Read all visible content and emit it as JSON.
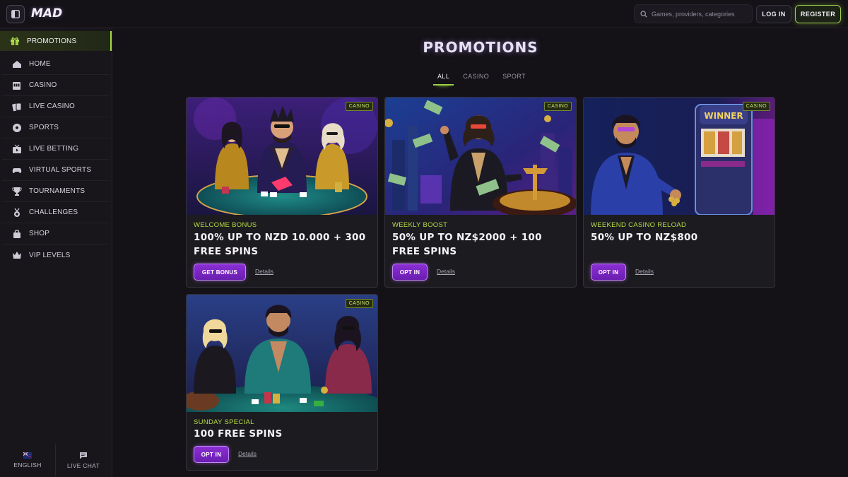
{
  "header": {
    "logo": "MAD",
    "search_placeholder": "Games, providers, categories",
    "login_label": "LOG IN",
    "register_label": "REGISTER"
  },
  "sidebar": {
    "items": [
      {
        "label": "PROMOTIONS",
        "icon": "gift-icon",
        "active": true
      },
      {
        "label": "HOME",
        "icon": "home-icon"
      },
      {
        "label": "CASINO",
        "icon": "slot-machine-icon"
      },
      {
        "label": "LIVE CASINO",
        "icon": "cards-icon"
      },
      {
        "label": "SPORTS",
        "icon": "soccer-ball-icon"
      },
      {
        "label": "LIVE BETTING",
        "icon": "tv-icon"
      },
      {
        "label": "VIRTUAL SPORTS",
        "icon": "gamepad-icon"
      },
      {
        "label": "TOURNAMENTS",
        "icon": "trophy-icon"
      },
      {
        "label": "CHALLENGES",
        "icon": "medal-icon"
      },
      {
        "label": "SHOP",
        "icon": "bag-icon"
      },
      {
        "label": "VIP LEVELS",
        "icon": "crown-icon"
      }
    ],
    "language_label": "ENGLISH",
    "live_chat_label": "LIVE CHAT"
  },
  "main": {
    "title": "PROMOTIONS",
    "filters": [
      "ALL",
      "CASINO",
      "SPORT"
    ],
    "active_filter": "ALL",
    "promotions": [
      {
        "badge": "CASINO",
        "category": "WELCOME BONUS",
        "headline": "100% UP TO NZD 10.000 + 300 FREE SPINS",
        "cta": "GET BONUS",
        "details": "Details"
      },
      {
        "badge": "CASINO",
        "category": "WEEKLY BOOST",
        "headline": "50% UP TO NZ$2000 + 100 FREE SPINS",
        "cta": "OPT IN",
        "details": "Details"
      },
      {
        "badge": "CASINO",
        "category": "WEEKEND CASINO RELOAD",
        "headline": "50% UP TO NZ$800",
        "cta": "OPT IN",
        "details": "Details"
      },
      {
        "badge": "CASINO",
        "category": "SUNDAY SPECIAL",
        "headline": "100 FREE SPINS",
        "cta": "OPT IN",
        "details": "Details"
      }
    ]
  },
  "colors": {
    "accent_green": "#a7d84a",
    "accent_purple": "#8b2fd4",
    "background": "#141216"
  }
}
